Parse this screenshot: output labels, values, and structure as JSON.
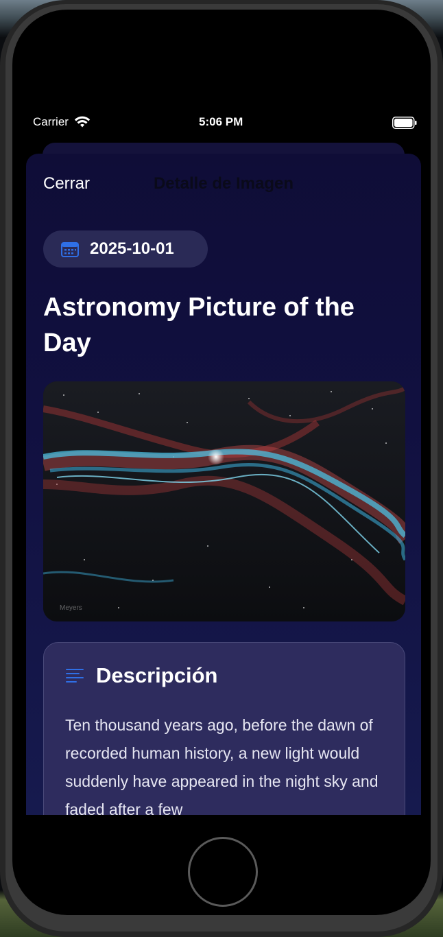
{
  "status_bar": {
    "carrier": "Carrier",
    "time": "5:06 PM",
    "icons": [
      "wifi-icon",
      "battery-icon"
    ]
  },
  "nav": {
    "close_label": "Cerrar",
    "title": "Detalle de Imagen"
  },
  "content": {
    "date": "2025-10-01",
    "date_icon": "calendar-icon",
    "title": "Astronomy Picture of the Day",
    "image_credit": "Meyers",
    "description": {
      "icon": "text-lines-icon",
      "heading": "Descripción",
      "text": "Ten thousand years ago, before the dawn of recorded human history, a new light would suddenly have appeared in the night sky and faded after a few"
    }
  },
  "colors": {
    "accent": "#2f6fe6",
    "sheet_background": "#111040",
    "card_background": "#2e2c5e"
  }
}
